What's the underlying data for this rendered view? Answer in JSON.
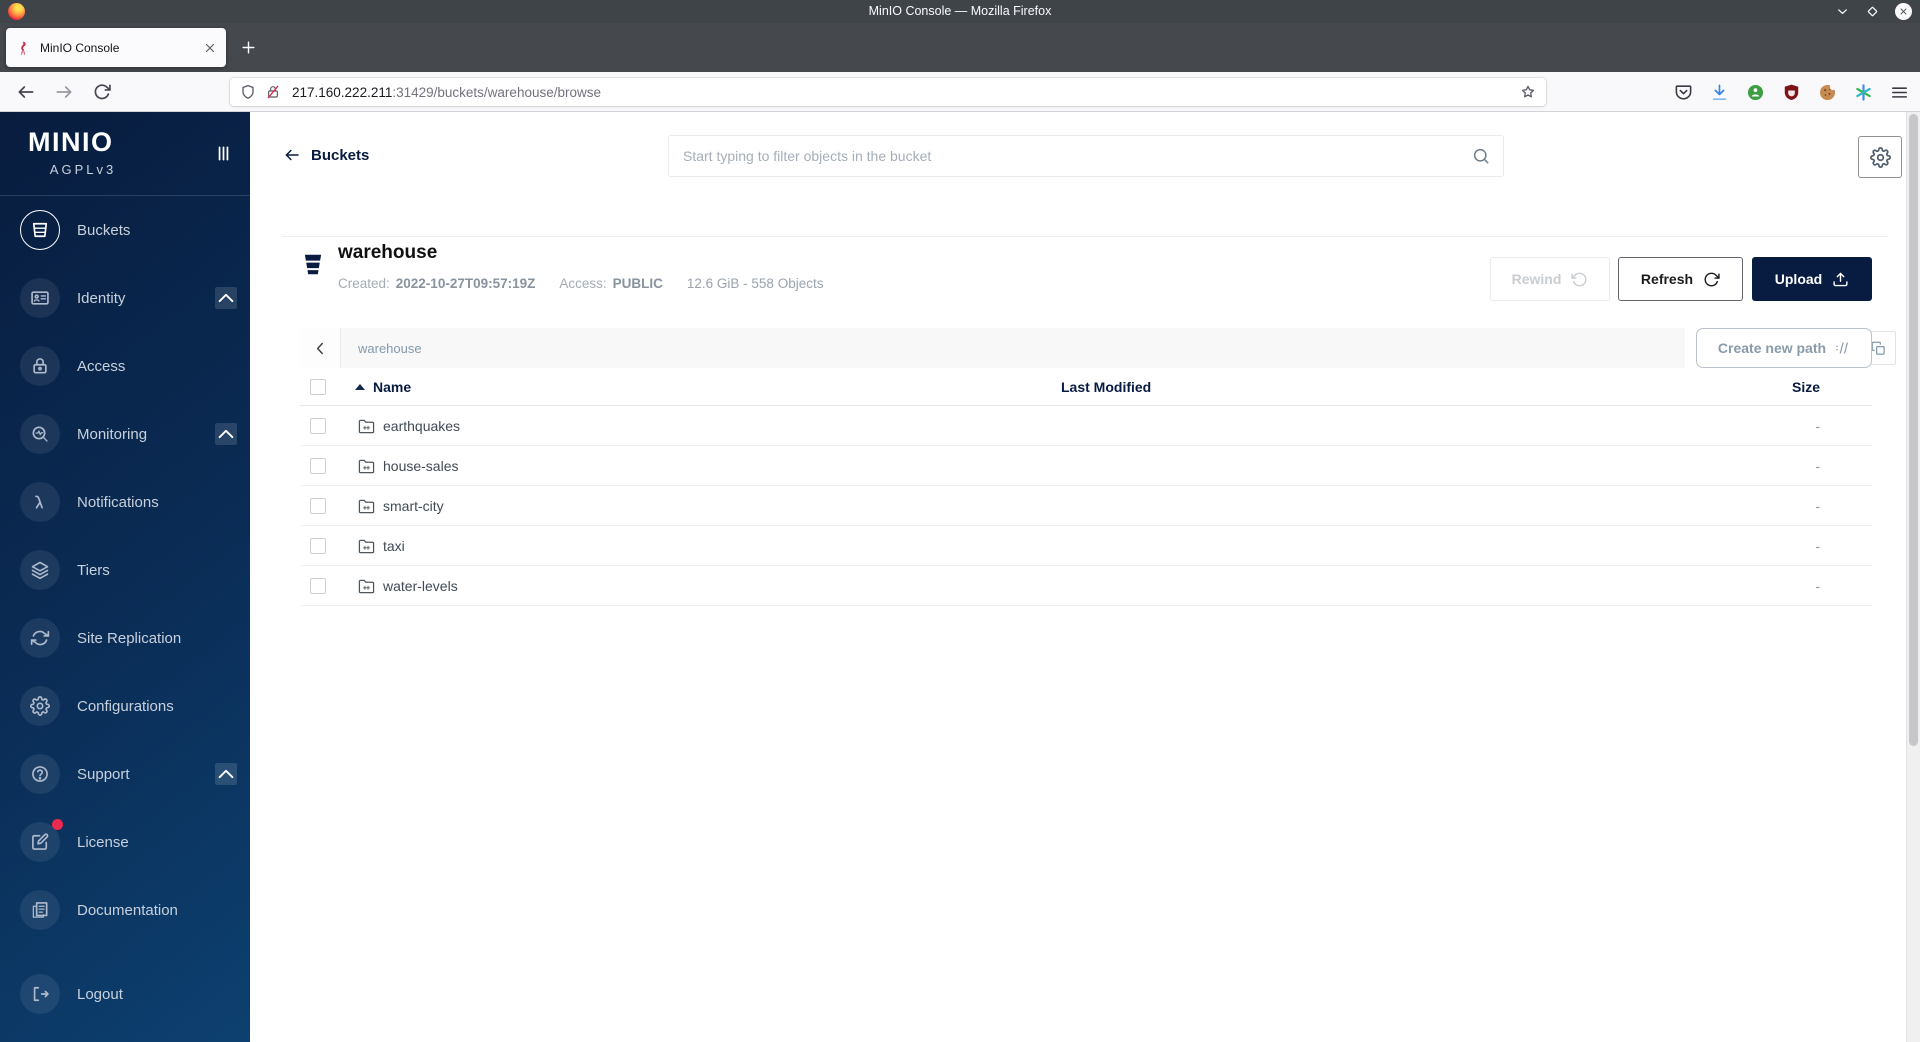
{
  "window": {
    "title": "MinIO Console — Mozilla Firefox"
  },
  "browser": {
    "tab_title": "MinIO Console",
    "url_host": "217.160.222.211",
    "url_rest": ":31429/buckets/warehouse/browse",
    "toolbar_icons": [
      "pocket-icon",
      "downloads-icon",
      "privacy-extension-icon",
      "ublock-icon",
      "cookie-extension-icon",
      "asterisk-extension-icon",
      "menu-icon"
    ]
  },
  "sidebar": {
    "logo": "MINIO",
    "license_tag": "AGPLv3",
    "items": [
      {
        "label": "Buckets",
        "icon": "buckets-icon",
        "selected": true
      },
      {
        "label": "Identity",
        "icon": "identity-icon",
        "expandable": true
      },
      {
        "label": "Access",
        "icon": "access-icon"
      },
      {
        "label": "Monitoring",
        "icon": "monitoring-icon",
        "expandable": true
      },
      {
        "label": "Notifications",
        "icon": "notifications-icon"
      },
      {
        "label": "Tiers",
        "icon": "tiers-icon"
      },
      {
        "label": "Site Replication",
        "icon": "site-replication-icon"
      },
      {
        "label": "Configurations",
        "icon": "configurations-icon"
      },
      {
        "label": "Support",
        "icon": "support-icon",
        "expandable": true
      },
      {
        "label": "License",
        "icon": "license-icon",
        "badge": true
      },
      {
        "label": "Documentation",
        "icon": "documentation-icon"
      },
      {
        "label": "Logout",
        "icon": "logout-icon"
      }
    ]
  },
  "header": {
    "back_label": "Buckets",
    "search_placeholder": "Start typing to filter objects in the bucket"
  },
  "bucket": {
    "name": "warehouse",
    "created_label": "Created:",
    "created": "2022-10-27T09:57:19Z",
    "access_label": "Access:",
    "access": "PUBLIC",
    "summary": "12.6 GiB - 558 Objects",
    "rewind_label": "Rewind",
    "refresh_label": "Refresh",
    "upload_label": "Upload"
  },
  "pathbar": {
    "path": "warehouse",
    "create_label": "Create new path"
  },
  "table": {
    "headers": {
      "name": "Name",
      "modified": "Last Modified",
      "size": "Size"
    },
    "rows": [
      {
        "name": "earthquakes",
        "modified": "",
        "size": "-"
      },
      {
        "name": "house-sales",
        "modified": "",
        "size": "-"
      },
      {
        "name": "smart-city",
        "modified": "",
        "size": "-"
      },
      {
        "name": "taxi",
        "modified": "",
        "size": "-"
      },
      {
        "name": "water-levels",
        "modified": "",
        "size": "-"
      }
    ]
  },
  "colors": {
    "brand_navy": "#081c42",
    "sidebar_gradient_start": "#081c3e",
    "sidebar_gradient_end": "#0d4070",
    "badge_red": "#e9294f",
    "upload_button_bg": "#081c42"
  }
}
